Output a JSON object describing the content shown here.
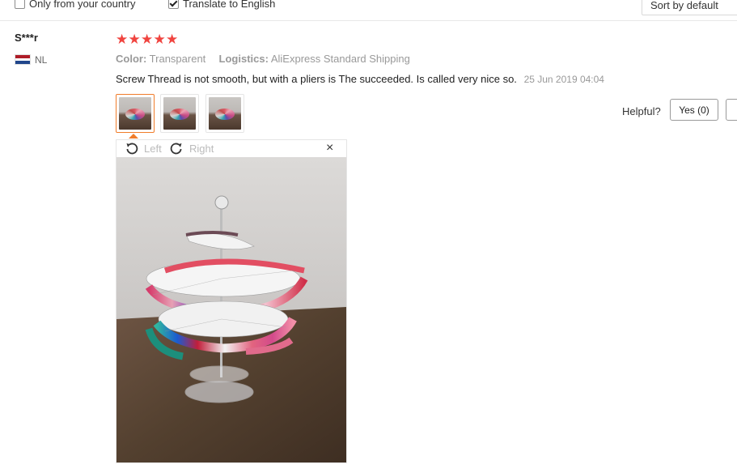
{
  "filters": {
    "only_country": {
      "label": "Only from your country",
      "checked": false
    },
    "translate": {
      "label": "Translate to English",
      "checked": true
    },
    "sort": "Sort by default"
  },
  "review": {
    "user": "S***r",
    "country_code": "NL",
    "rating": 5,
    "star_glyph": "★",
    "color_key": "Color:",
    "color_value": "Transparent",
    "logistics_key": "Logistics:",
    "logistics_value": "AliExpress Standard Shipping",
    "text": "Screw Thread is not smooth, but with a pliers is The succeeded. Is called very nice so.",
    "date": "25 Jun 2019 04:04",
    "thumbnails": 3,
    "helpful_label": "Helpful?",
    "yes_label": "Yes (0)"
  },
  "viewer": {
    "rotate_left": "Left",
    "rotate_right": "Right",
    "close": "×"
  },
  "colors": {
    "star": "#f0443f",
    "active_thumb": "#f07c2a",
    "muted": "#999999"
  }
}
